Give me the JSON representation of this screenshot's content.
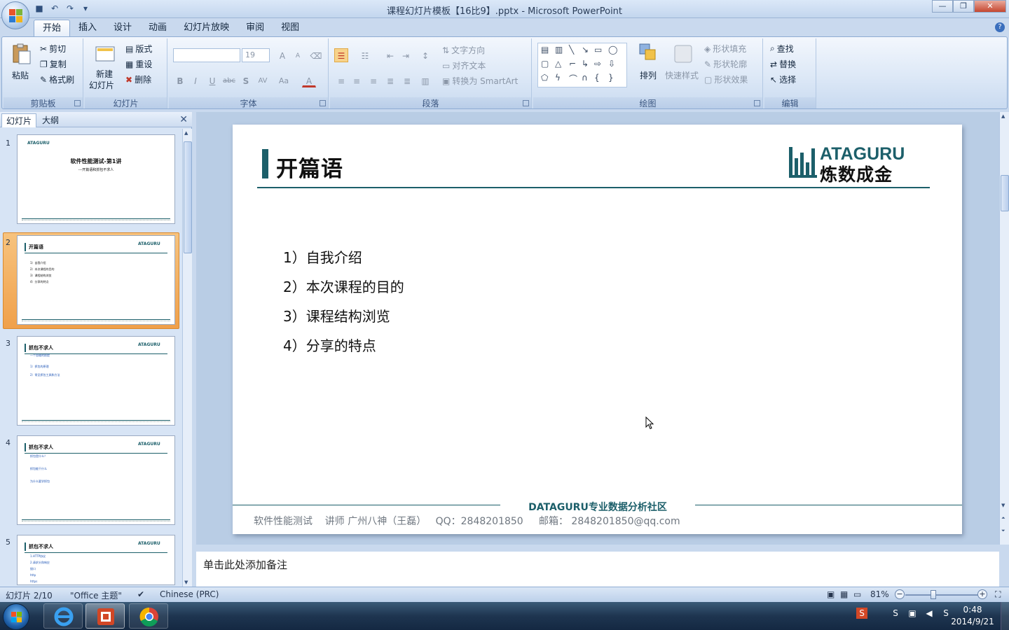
{
  "window": {
    "title": "课程幻灯片模板【16比9】.pptx - Microsoft PowerPoint",
    "controls": [
      "minimize",
      "restore",
      "close"
    ]
  },
  "qat": [
    "save-icon",
    "undo-icon",
    "redo-icon",
    "customize-icon"
  ],
  "ribbon": {
    "tabs": [
      "开始",
      "插入",
      "设计",
      "动画",
      "幻灯片放映",
      "审阅",
      "视图"
    ],
    "active_tab": "开始",
    "clipboard": {
      "label": "剪贴板",
      "paste": "粘贴",
      "cut": "剪切",
      "copy": "复制",
      "painter": "格式刷"
    },
    "slides": {
      "label": "幻灯片",
      "new_line1": "新建",
      "new_line2": "幻灯片",
      "layout": "版式",
      "reset": "重设",
      "delete": "删除"
    },
    "font": {
      "label": "字体",
      "font_name": "",
      "font_size": "19",
      "bold": "B",
      "italic": "I",
      "underline": "U",
      "strike": "abc",
      "shadow": "S",
      "spacing": "AV",
      "case": "Aa",
      "color": "A",
      "grow": "A",
      "shrink": "A"
    },
    "paragraph": {
      "label": "段落",
      "text_direction": "文字方向",
      "align_text": "对齐文本",
      "smartart": "转换为 SmartArt"
    },
    "drawing": {
      "label": "绘图",
      "arrange": "排列",
      "quick_styles": "快速样式",
      "fill": "形状填充",
      "outline": "形状轮廓",
      "effects": "形状效果"
    },
    "editing": {
      "label": "编辑",
      "find": "查找",
      "replace": "替换",
      "select": "选择"
    }
  },
  "pane": {
    "tabs": [
      "幻灯片",
      "大纲"
    ],
    "thumbs": [
      {
        "num": "1",
        "title": "软件性能测试-第1讲",
        "subtitle": "---开篇语和抓包不求人"
      },
      {
        "num": "2",
        "title": "开篇语",
        "bullets": [
          "1）自我介绍",
          "2）本次课程的目的",
          "3）课程结构浏览",
          "4）分享的特点"
        ]
      },
      {
        "num": "3",
        "title": "抓包不求人",
        "bullets": [
          "一个思维的前提",
          "1）抓包的原理",
          "2）常见抓包工具和方法"
        ]
      },
      {
        "num": "4",
        "title": "抓包不求人",
        "bullets": [
          "抓包是什么？",
          "抓包能干什么",
          "为什么要学抓包"
        ]
      },
      {
        "num": "5",
        "title": "抓包不求人",
        "bullets": [
          "1.HTTP协议",
          "2.请求头和响应",
          "接口",
          "http",
          "https"
        ]
      }
    ]
  },
  "slide": {
    "title": "开篇语",
    "logo_line1": "ATAGURU",
    "logo_line2": "炼数成金",
    "items": [
      "1）自我介绍",
      "2）本次课程的目的",
      "3）课程结构浏览",
      "4）分享的特点"
    ],
    "footer_center": "DATAGURU专业数据分析社区",
    "footer_info": "软件性能测试    讲师 广州八神（王磊）   QQ：2848201850     邮箱： 2848201850@qq.com"
  },
  "notes": {
    "placeholder": "单击此处添加备注"
  },
  "status": {
    "slide_pos": "幻灯片 2/10",
    "theme": "\"Office 主题\"",
    "language": "Chinese (PRC)",
    "zoom": "81%"
  },
  "taskbar": {
    "apps": [
      "ie-icon",
      "powerpoint-icon",
      "chrome-icon"
    ],
    "time": "0:48",
    "date": "2014/9/21"
  },
  "colors": {
    "accent": "#1c5f6a",
    "selection": "#f0a04a",
    "ribbon": "#dbe7f6"
  }
}
